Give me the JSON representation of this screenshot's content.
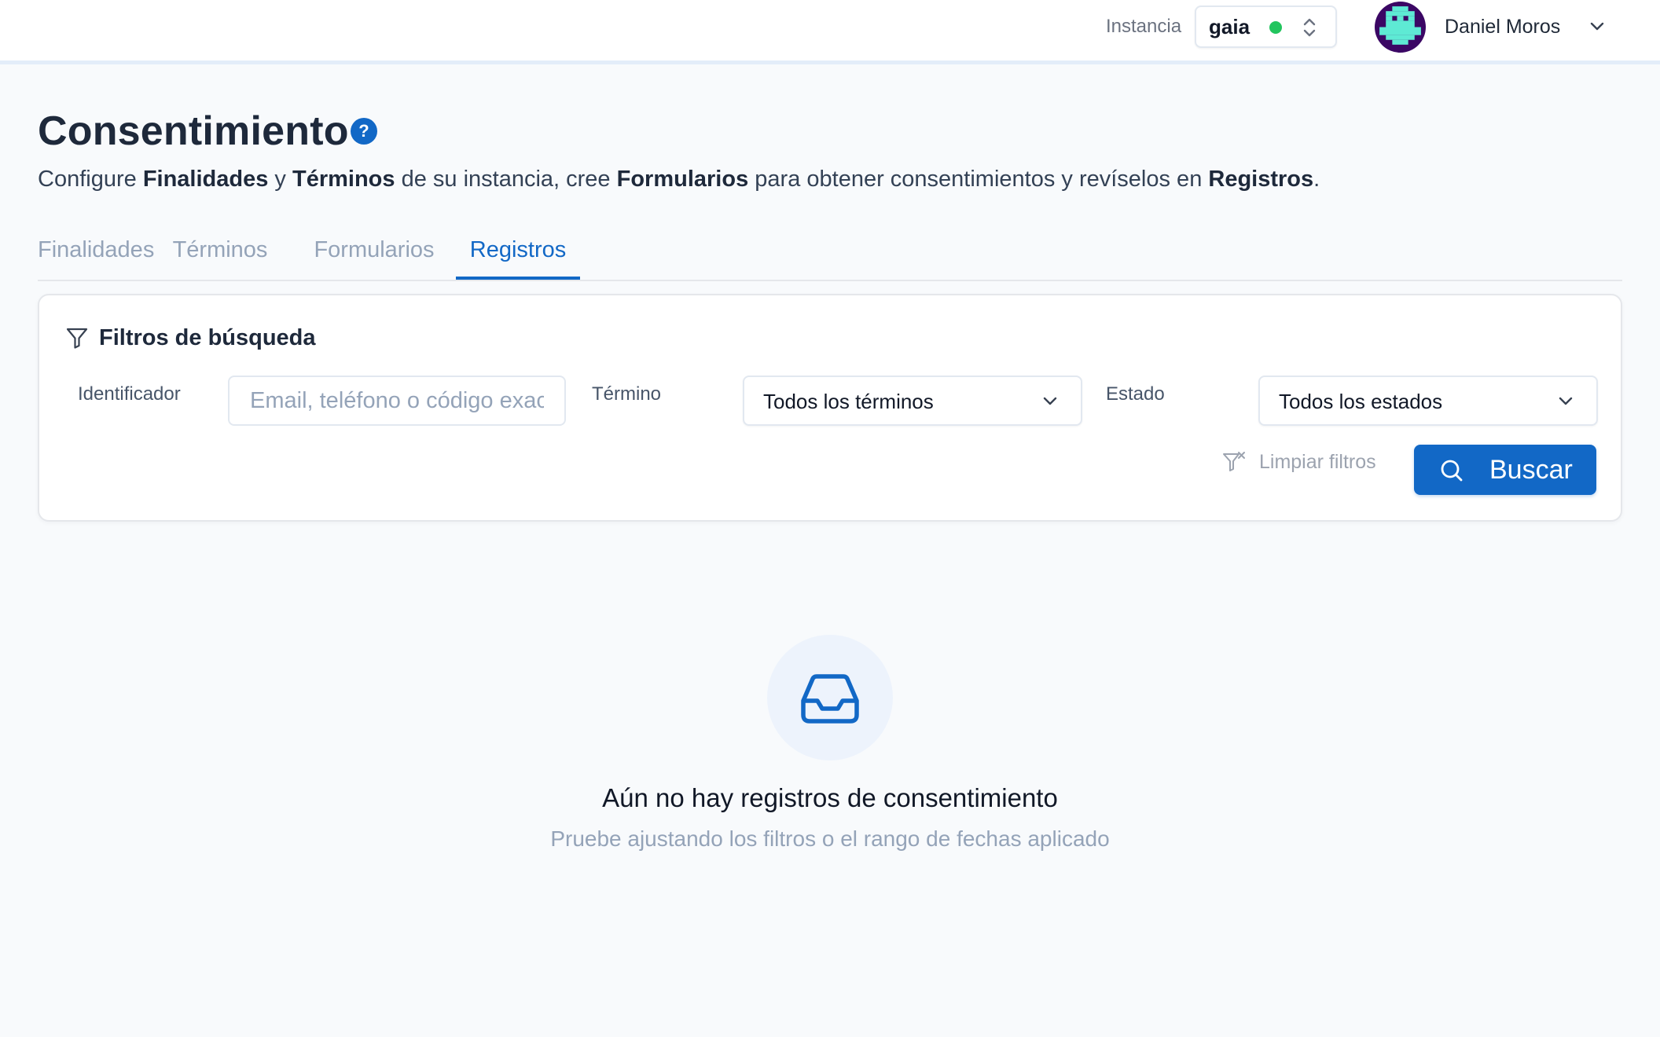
{
  "colors": {
    "accent": "#1268c6",
    "status_online": "#22c55e",
    "avatar_bg": "#3b0764",
    "avatar_figure": "#5eead4"
  },
  "header": {
    "instance_label": "Instancia",
    "instance_value": "gaia",
    "instance_status": "online",
    "user_name": "Daniel Moros",
    "avatar_icon": "pixel-avatar-icon",
    "user_menu_icon": "chevron-down-icon",
    "instance_switch_icon": "chevron-up-down-icon"
  },
  "page": {
    "title": "Consentimiento",
    "help_icon": "question-circle-icon",
    "help_symbol": "?",
    "description": {
      "t1": "Configure ",
      "b1": "Finalidades",
      "t2": " y ",
      "b2": "Términos",
      "t3": " de su instancia, cree ",
      "b3": "Formularios",
      "t4": " para obtener consentimientos y revíselos en ",
      "b4": "Registros",
      "t5": "."
    }
  },
  "tabs": [
    {
      "label": "Finalidades",
      "active": false
    },
    {
      "label": "Términos",
      "active": false
    },
    {
      "label": "Formularios",
      "active": false
    },
    {
      "label": "Registros",
      "active": true
    }
  ],
  "filters": {
    "title": "Filtros de búsqueda",
    "title_icon": "funnel-icon",
    "identifier_label": "Identificador",
    "identifier_value": "",
    "identifier_placeholder": "Email, teléfono o código exacto",
    "term_label": "Término",
    "term_value": "Todos los términos",
    "status_label": "Estado",
    "status_value": "Todos los estados",
    "clear_label": "Limpiar filtros",
    "clear_icon": "funnel-x-icon",
    "search_label": "Buscar",
    "search_icon": "search-icon"
  },
  "empty_state": {
    "icon": "inbox-icon",
    "title": "Aún no hay registros de consentimiento",
    "subtitle": "Pruebe ajustando los filtros o el rango de fechas aplicado"
  }
}
